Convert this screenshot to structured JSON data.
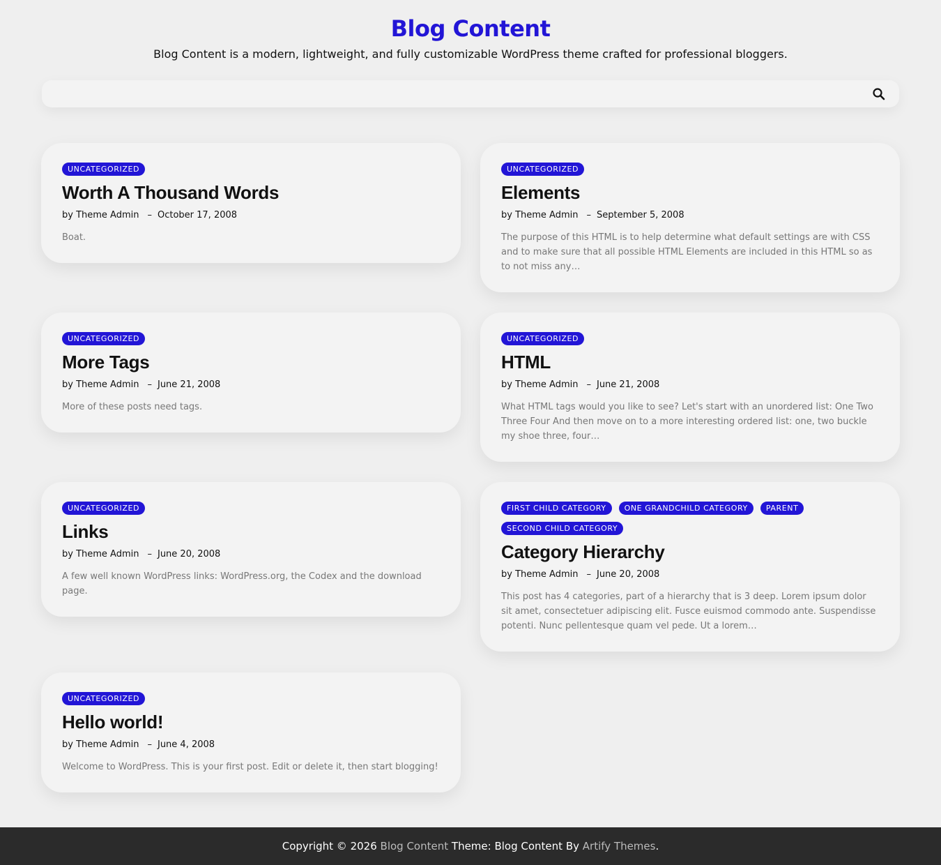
{
  "site": {
    "title": "Blog Content",
    "description": "Blog Content is a modern, lightweight, and fully customizable WordPress theme crafted for professional bloggers."
  },
  "search": {
    "placeholder": "",
    "icon": "search-icon"
  },
  "posts": [
    {
      "categories": [
        "UNCATEGORIZED"
      ],
      "title": "Worth A Thousand Words",
      "author": "by Theme Admin",
      "date": "October 17, 2008",
      "excerpt": "Boat."
    },
    {
      "categories": [
        "UNCATEGORIZED"
      ],
      "title": "Elements",
      "author": "by Theme Admin",
      "date": "September 5, 2008",
      "excerpt": "The purpose of this HTML is to help determine what default settings are with CSS and to make sure that all possible HTML Elements are included in this HTML so as to not miss any…"
    },
    {
      "categories": [
        "UNCATEGORIZED"
      ],
      "title": "More Tags",
      "author": "by Theme Admin",
      "date": "June 21, 2008",
      "excerpt": "More of these posts need tags."
    },
    {
      "categories": [
        "UNCATEGORIZED"
      ],
      "title": "HTML",
      "author": "by Theme Admin",
      "date": "June 21, 2008",
      "excerpt": "What HTML tags would you like to see? Let's start with an unordered list: One Two Three Four And then move on to a more interesting ordered list: one, two buckle my shoe three, four…"
    },
    {
      "categories": [
        "UNCATEGORIZED"
      ],
      "title": "Links",
      "author": "by Theme Admin",
      "date": "June 20, 2008",
      "excerpt": "A few well known WordPress links: WordPress.org, the Codex and the download page."
    },
    {
      "categories": [
        "FIRST CHILD CATEGORY",
        "ONE GRANDCHILD CATEGORY",
        "PARENT",
        "SECOND CHILD CATEGORY"
      ],
      "title": "Category Hierarchy",
      "author": "by Theme Admin",
      "date": "June 20, 2008",
      "excerpt": "This post has 4 categories, part of a hierarchy that is 3 deep. Lorem ipsum dolor sit amet, consectetuer adipiscing elit. Fusce euismod commodo ante. Suspendisse potenti. Nunc pellentesque quam vel pede. Ut a lorem…"
    },
    {
      "categories": [
        "UNCATEGORIZED"
      ],
      "title": "Hello world!",
      "author": "by Theme Admin",
      "date": "June 4, 2008",
      "excerpt": "Welcome to WordPress. This is your first post. Edit or delete it, then start blogging!"
    }
  ],
  "footer": {
    "prefix": "Copyright © 2026",
    "site_link": "Blog Content",
    "middle": "Theme: Blog Content By",
    "author_link": "Artify Themes",
    "suffix": "."
  },
  "colors": {
    "accent": "#2215d6",
    "background": "#efefef",
    "card": "#f3f3f3",
    "footer": "#2b2b2b"
  }
}
